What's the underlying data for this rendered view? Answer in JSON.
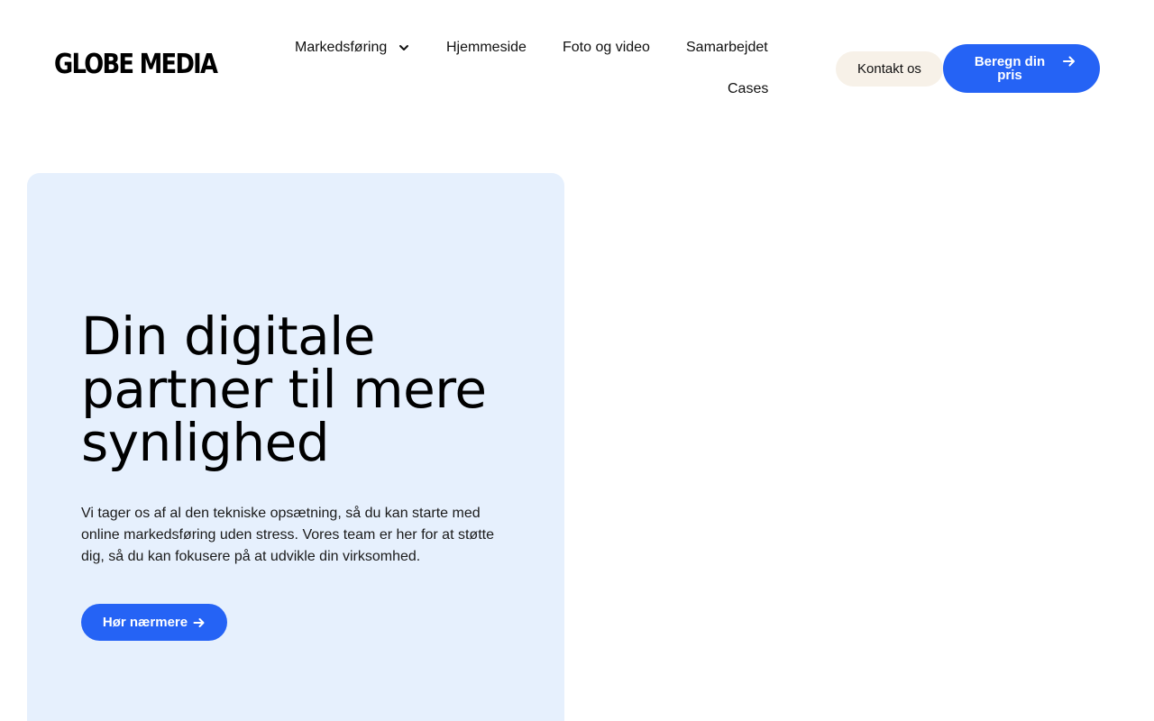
{
  "header": {
    "logo": "GLOBE MEDIA",
    "nav": {
      "markedsforing": "Markedsføring",
      "hjemmeside": "Hjemmeside",
      "foto": "Foto og video",
      "samarbejdet": "Samarbejdet",
      "cases": "Cases"
    },
    "contact_label": "Kontakt os",
    "price_label": "Beregn din pris"
  },
  "hero": {
    "title": "Din digitale partner til mere synlighed",
    "text": "Vi tager os af al den tekniske opsætning, så du kan starte med online markedsføring uden stress. Vores team er her for at støtte dig, så du kan fokusere på at udvikle din virksomhed.",
    "button_label": "Hør nærmere"
  },
  "icons": {
    "chevron": "chevron-down-icon",
    "arrow": "arrow-right-icon"
  },
  "colors": {
    "accent": "#2563f5",
    "hero_bg": "#e6f0fd",
    "contact_bg": "#f7f1e8"
  }
}
